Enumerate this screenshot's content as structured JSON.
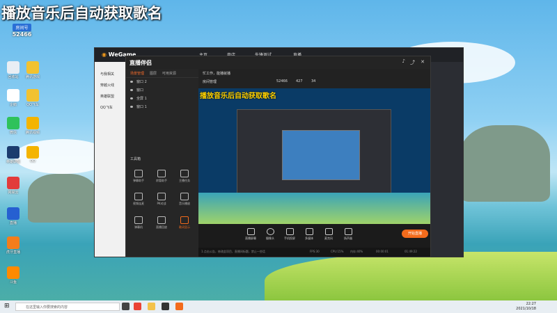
{
  "watermark": {
    "title": "播放音乐后自动获取歌名"
  },
  "streamer": {
    "tag": "房间号",
    "room": "52466"
  },
  "desktop_icons": [
    {
      "label": "回收站",
      "color": "#e9eef4"
    },
    {
      "label": "腾讯游戏",
      "color": "#f2c230"
    },
    {
      "label": "企鹅",
      "color": "#ffffff"
    },
    {
      "label": "微信",
      "color": "#2fc25b"
    },
    {
      "label": "英雄联盟",
      "color": "#1c3c6e"
    },
    {
      "label": "网易云",
      "color": "#e23b3b"
    },
    {
      "label": "直播",
      "color": "#2660d1"
    },
    {
      "label": "虎牙直播",
      "color": "#f37d1b"
    },
    {
      "label": "斗鱼",
      "color": "#ff8a00"
    },
    {
      "label": "QQ飞车",
      "color": "#f4b400"
    },
    {
      "label": "腾讯视频",
      "color": "#2b7be6"
    },
    {
      "label": "QQ",
      "color": "#ffffff"
    }
  ],
  "wegame": {
    "logo": "WeGame",
    "tabs": [
      "主页",
      "商店",
      "先锋测试",
      "直播"
    ],
    "side_items": [
      "与我相关",
      "穿越火线",
      "英雄联盟",
      "QQ飞车"
    ],
    "colors": {
      "brand": "#f39b1c"
    }
  },
  "helper": {
    "logo": "直播伴侣",
    "tabs": [
      "场景管理",
      "图层",
      "可用资源"
    ],
    "scenes": [
      "窗口 2",
      "窗口",
      "全屏 1",
      "窗口 1"
    ],
    "tools_title": "工具箱",
    "tools": [
      "弹幕助手",
      "房管助手",
      "主播任务",
      "视频连麦",
      "PK对战",
      "音乐播放",
      "弹幕机",
      "直播回放",
      "歌词显示"
    ],
    "info": {
      "line1": "忙工作，能播就播",
      "line2": "房间管理",
      "room": "52466",
      "likes": "427",
      "viewers": "34"
    },
    "preview_title": "播放音乐后自动获取歌名",
    "bottom_buttons": [
      "直播屏幕",
      "摄像头",
      "手机投屏",
      "多媒体",
      "麦克风",
      "扬声器"
    ],
    "start_button": "开始直播",
    "status": {
      "left": "1.点击公告，修改此项目，直播间标题，禁止一些话",
      "fps": "FPS:30",
      "cpu": "CPU:15%",
      "mem": "内存:40%",
      "time1": "00:00:01",
      "time2": "01:49:22"
    },
    "colors": {
      "accent": "#f36b1c"
    }
  },
  "taskbar": {
    "search_placeholder": "在这里输入你要搜索的内容",
    "time": "22:27",
    "date": "2021/10/18"
  }
}
